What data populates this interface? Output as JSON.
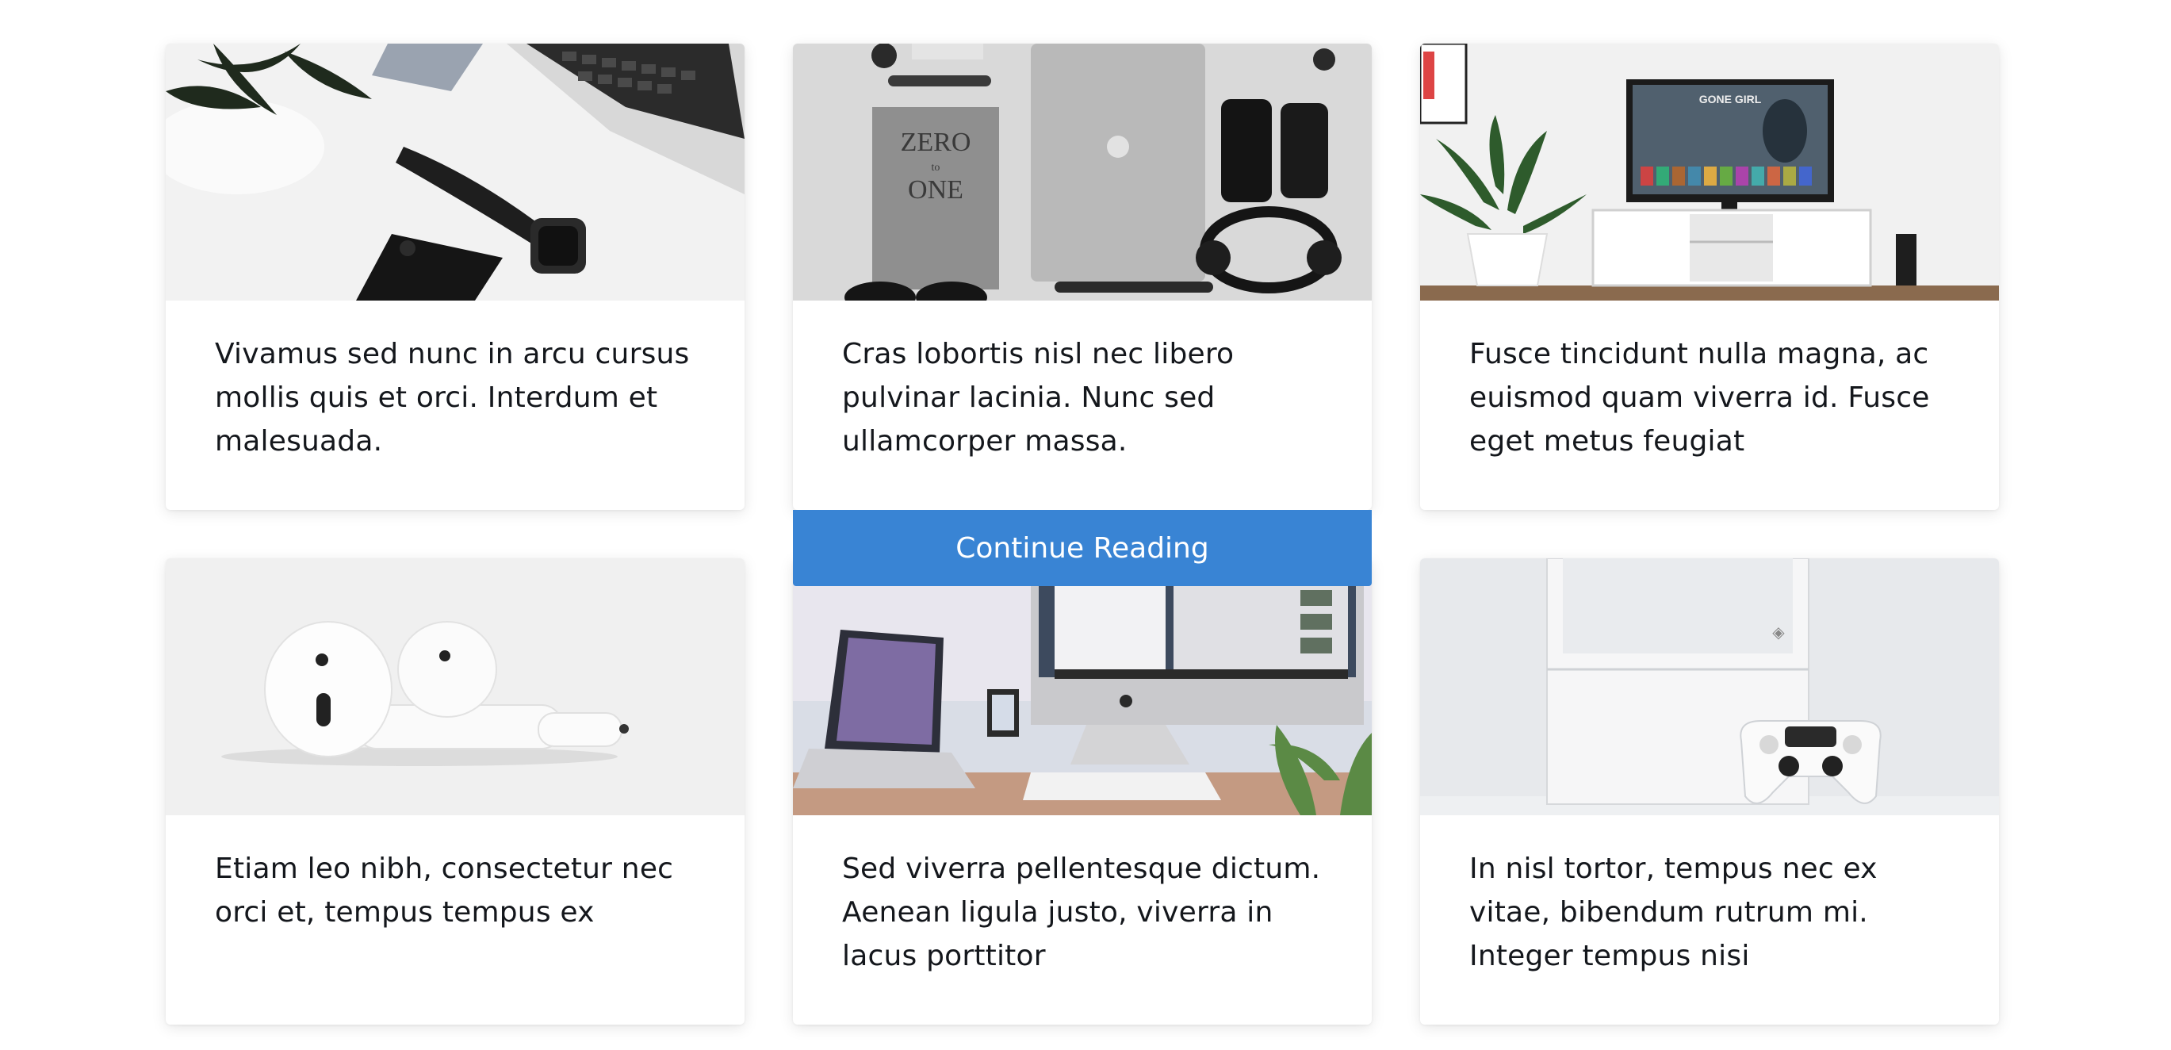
{
  "cards": [
    {
      "title": "Vivamus sed nunc in arcu cursus mollis quis et orci. Interdum et malesuada.",
      "image": "laptop-watch-phone-desk-photo"
    },
    {
      "title": "Cras lobortis nisl nec libero pulvinar lacinia. Nunc sed ullamcorper massa.",
      "image": "book-laptop-headphones-flatlay-photo"
    },
    {
      "title": "Fusce tincidunt nulla magna, ac euismod quam viverra id. Fusce eget metus feugiat",
      "image": "tv-stand-plant-photo"
    },
    {
      "title": "Etiam leo nibh, consectetur nec orci et, tempus tempus ex",
      "image": "airpods-photo"
    },
    {
      "title": "Sed viverra pellentesque dictum. Aenean ligula justo, viverra in lacus porttitor",
      "image": "imac-laptop-desk-photo"
    },
    {
      "title": "In nisl tortor, tempus nec ex vitae, bibendum rutrum mi. Integer tempus nisi",
      "image": "game-console-controller-photo"
    }
  ],
  "tv_screen_text": "GONE GIRL",
  "book_cover_text": [
    "ZERO",
    "to",
    "ONE"
  ],
  "continue_label": "Continue Reading",
  "colors": {
    "accent": "#3984d4",
    "title_text": "#14171c"
  }
}
